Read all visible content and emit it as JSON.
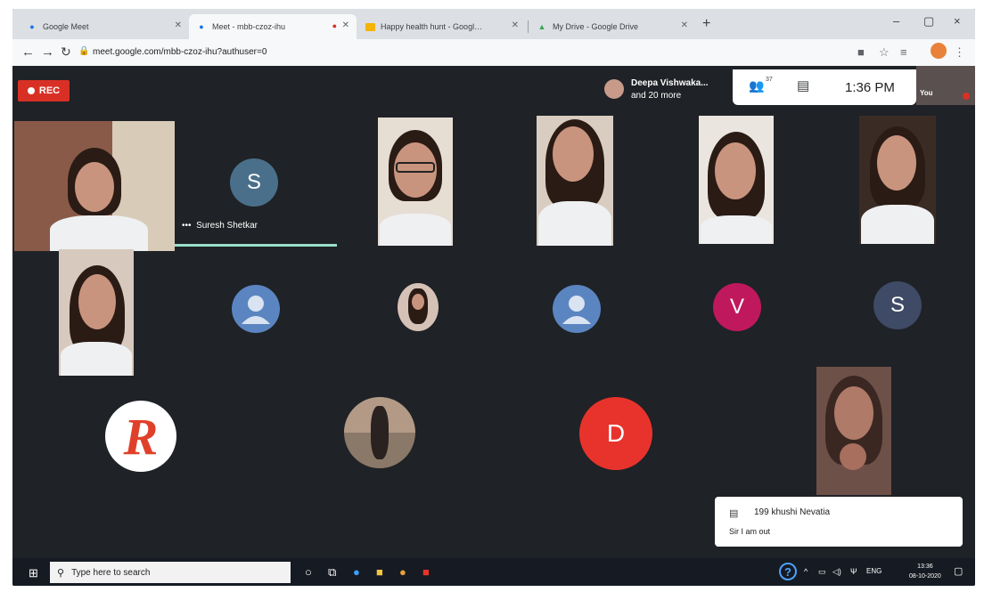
{
  "browser": {
    "tabs": [
      {
        "title": "Google Meet",
        "icon": "meet-icon"
      },
      {
        "title": "Meet - mbb-czoz-ihu",
        "icon": "meet-icon",
        "active": true
      },
      {
        "title": "Happy health hunt - Google Sli",
        "icon": "slides-icon"
      },
      {
        "title": "My Drive - Google Drive",
        "icon": "drive-icon"
      }
    ],
    "new_tab": "+",
    "url": "meet.google.com/mbb-czoz-ihu?authuser=0",
    "window_controls": {
      "minimize": "–",
      "maximize": "▢",
      "close": "×"
    }
  },
  "meet": {
    "rec_label": "REC",
    "presence_line1": "Deepa Vishwaka...",
    "presence_line2": "and 20 more",
    "participant_count": "37",
    "time": "1:36 PM",
    "self_label": "You",
    "participants": [
      {
        "type": "video",
        "name": ""
      },
      {
        "type": "avatar",
        "letter": "S",
        "name": "Suresh Shetkar",
        "color": "#4a6f8a"
      },
      {
        "type": "video"
      },
      {
        "type": "video"
      },
      {
        "type": "video"
      },
      {
        "type": "video"
      },
      {
        "type": "video"
      },
      {
        "type": "avatar",
        "letter": "",
        "color": "#5b85c0"
      },
      {
        "type": "photo-avatar"
      },
      {
        "type": "avatar",
        "letter": "",
        "color": "#5b85c0"
      },
      {
        "type": "avatar",
        "letter": "V",
        "color": "#c0185d"
      },
      {
        "type": "avatar",
        "letter": "S",
        "color": "#3f4a66"
      },
      {
        "type": "logo-avatar",
        "letter": "R"
      },
      {
        "type": "photo-avatar"
      },
      {
        "type": "avatar",
        "letter": "D",
        "color": "#e8332c"
      },
      {
        "type": "video"
      }
    ],
    "name_label": "Suresh Shetkar",
    "name_label_more": "•••",
    "chat_toast": {
      "sender": "199 khushi Nevatia",
      "message": "Sir I am out"
    }
  },
  "taskbar": {
    "search_placeholder": "Type here to search",
    "language": "ENG",
    "clock_time": "13:36",
    "clock_date": "08-10-2020"
  }
}
